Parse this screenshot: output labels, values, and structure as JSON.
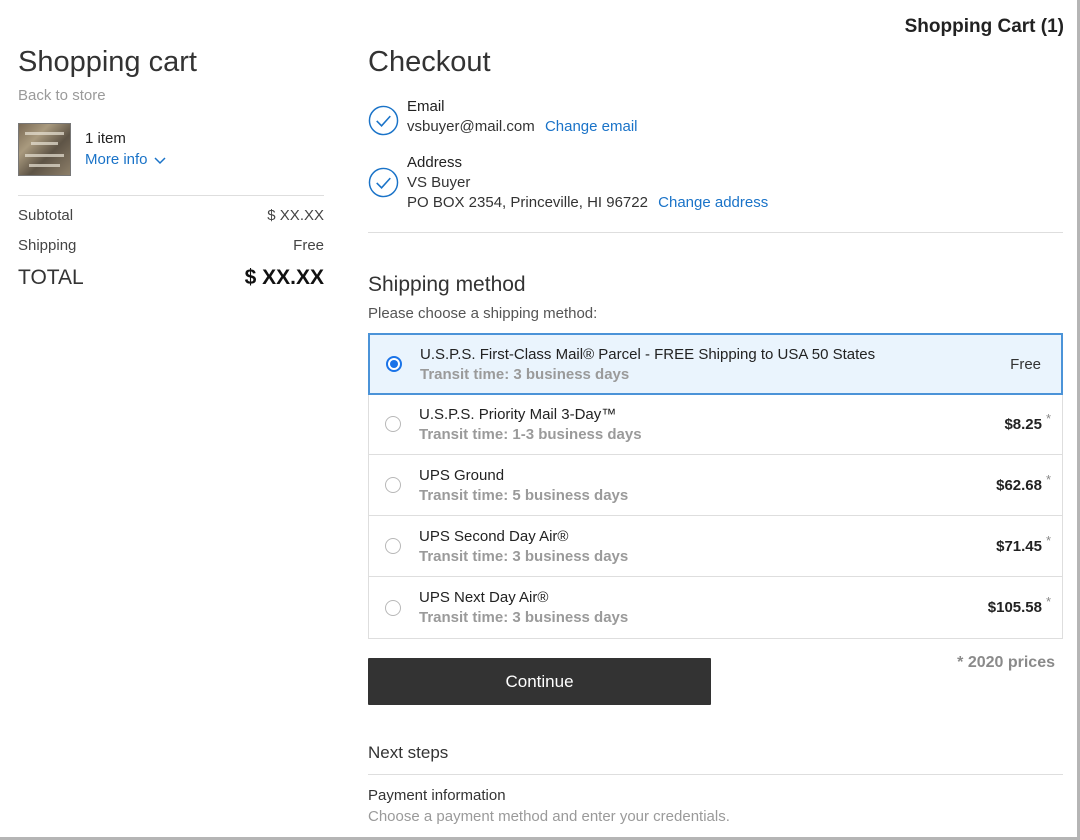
{
  "header": {
    "cart_link": "Shopping Cart (1)"
  },
  "sidebar": {
    "title": "Shopping cart",
    "back_link": "Back to store",
    "item_count": "1 item",
    "more_info": "More info",
    "subtotal_label": "Subtotal",
    "subtotal_value": "$ XX.XX",
    "shipping_label": "Shipping",
    "shipping_value": "Free",
    "total_label": "TOTAL",
    "total_value": "$ XX.XX"
  },
  "checkout": {
    "title": "Checkout",
    "email_label": "Email",
    "email_value": "vsbuyer@mail.com",
    "change_email": "Change email",
    "address_label": "Address",
    "address_name": "VS Buyer",
    "address_line": "PO BOX 2354, Princeville, HI 96722",
    "change_address": "Change address"
  },
  "shipping": {
    "title": "Shipping method",
    "subtitle": "Please choose a shipping method:",
    "methods": [
      {
        "name": "U.S.P.S. First-Class Mail® Parcel - FREE Shipping to USA 50 States",
        "transit": "Transit time: 3 business days",
        "price": "Free",
        "star": ""
      },
      {
        "name": "U.S.P.S. Priority Mail 3-Day™",
        "transit": "Transit time: 1-3 business days",
        "price": "$8.25",
        "star": "*"
      },
      {
        "name": "UPS Ground",
        "transit": "Transit time: 5 business days",
        "price": "$62.68",
        "star": "*"
      },
      {
        "name": "UPS Second Day Air®",
        "transit": "Transit time: 3 business days",
        "price": "$71.45",
        "star": "*"
      },
      {
        "name": "UPS Next Day Air®",
        "transit": "Transit time: 3 business days",
        "price": "$105.58",
        "star": "*"
      }
    ],
    "continue_label": "Continue",
    "prices_note": "* 2020 prices"
  },
  "next_steps": {
    "title": "Next steps",
    "payment_title": "Payment information",
    "payment_sub": "Choose a payment method and enter your credentials."
  },
  "colors": {
    "accent": "#1a73c8",
    "selected_bg": "#eaf4fd",
    "selected_border": "#4b93d8",
    "button_bg": "#333333"
  }
}
